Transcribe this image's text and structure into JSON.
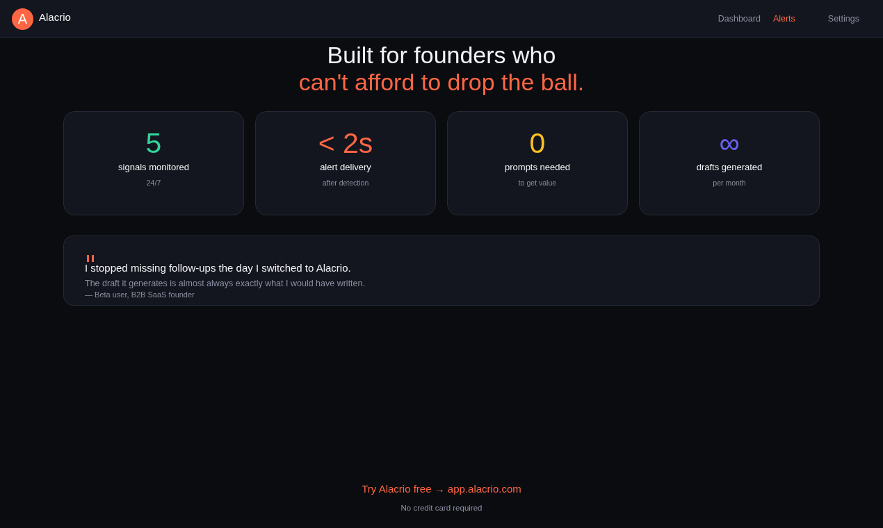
{
  "header": {
    "logo": {
      "letter": "A",
      "name": "Alacrio"
    },
    "nav": [
      {
        "label": "Dashboard",
        "selected": false
      },
      {
        "label": "Alerts",
        "selected": true
      },
      {
        "label": "Settings",
        "selected": false
      }
    ]
  },
  "headline": [
    {
      "text": "Built for founders who",
      "highlight": false
    },
    {
      "text": "can't afford to drop the ball.",
      "highlight": true
    }
  ],
  "stats": [
    {
      "value": "5",
      "label": "signals monitored",
      "note": "24/7",
      "color": "#34d399"
    },
    {
      "value": "< 2s",
      "label": "alert delivery",
      "note": "after detection",
      "color": "#ff6644"
    },
    {
      "value": "0",
      "label": "prompts needed",
      "note": "to get value",
      "color": "#fbbf24"
    },
    {
      "value": "∞",
      "label": "drafts generated",
      "note": "per month",
      "color": "#6c63f7"
    }
  ],
  "testimonial": {
    "quote": "I stopped missing follow-ups the day I switched to Alacrio.",
    "detail": "The draft it generates is almost always exactly what I would have written.",
    "attribution": "— Beta user, B2B SaaS founder"
  },
  "cta": {
    "link": "Try Alacrio free → app.alacrio.com",
    "note": "No credit card required"
  }
}
